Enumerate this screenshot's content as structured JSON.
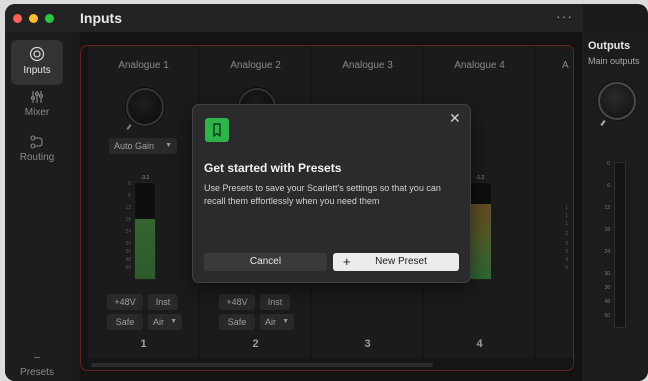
{
  "window": {
    "title": "Inputs",
    "more_label": "···"
  },
  "sidebar": {
    "items": [
      {
        "label": "Inputs",
        "icon": "input-icon",
        "active": true
      },
      {
        "label": "Mixer",
        "icon": "mixer-icon",
        "active": false
      },
      {
        "label": "Routing",
        "icon": "routing-icon",
        "active": false
      }
    ],
    "presets_label": "Presets"
  },
  "channels": [
    {
      "name": "Analogue 1",
      "number": "1",
      "gain_mode": "Auto Gain",
      "phantom": "+48V",
      "inst": "Inst",
      "safe": "Safe",
      "air": "Air",
      "peak": "-3.1",
      "level": 0.62
    },
    {
      "name": "Analogue 2",
      "number": "2",
      "phantom": "+48V",
      "inst": "Inst",
      "safe": "Safe",
      "air": "Air"
    },
    {
      "name": "Analogue 3",
      "number": "3"
    },
    {
      "name": "Analogue 4",
      "number": "4",
      "peak": "-1.2",
      "level": 0.78
    },
    {
      "name": "A"
    }
  ],
  "meter_scale": [
    "0",
    "6",
    "12",
    "18",
    "24",
    "30",
    "36",
    "48",
    "60"
  ],
  "meter_scale_partial": [
    "1",
    "1",
    "1",
    "2",
    "3",
    "3",
    "4",
    "6"
  ],
  "outputs": {
    "title": "Outputs",
    "subtitle": "Main outputs",
    "scale": [
      "0",
      "6",
      "12",
      "18",
      "24",
      "30",
      "36",
      "48",
      "60"
    ]
  },
  "modal": {
    "title": "Get started with Presets",
    "body": "Use Presets to save your Scarlett's settings so that you can recall them effortlessly when you need them",
    "cancel_label": "Cancel",
    "new_preset_label": "New Preset",
    "plus_glyph": "+",
    "close_glyph": "✕"
  },
  "colors": {
    "accent_green": "#2fb44a",
    "outline_red": "#8b2f2f",
    "meter_green": "#3f8f47",
    "meter_amber": "#8c6a35"
  }
}
